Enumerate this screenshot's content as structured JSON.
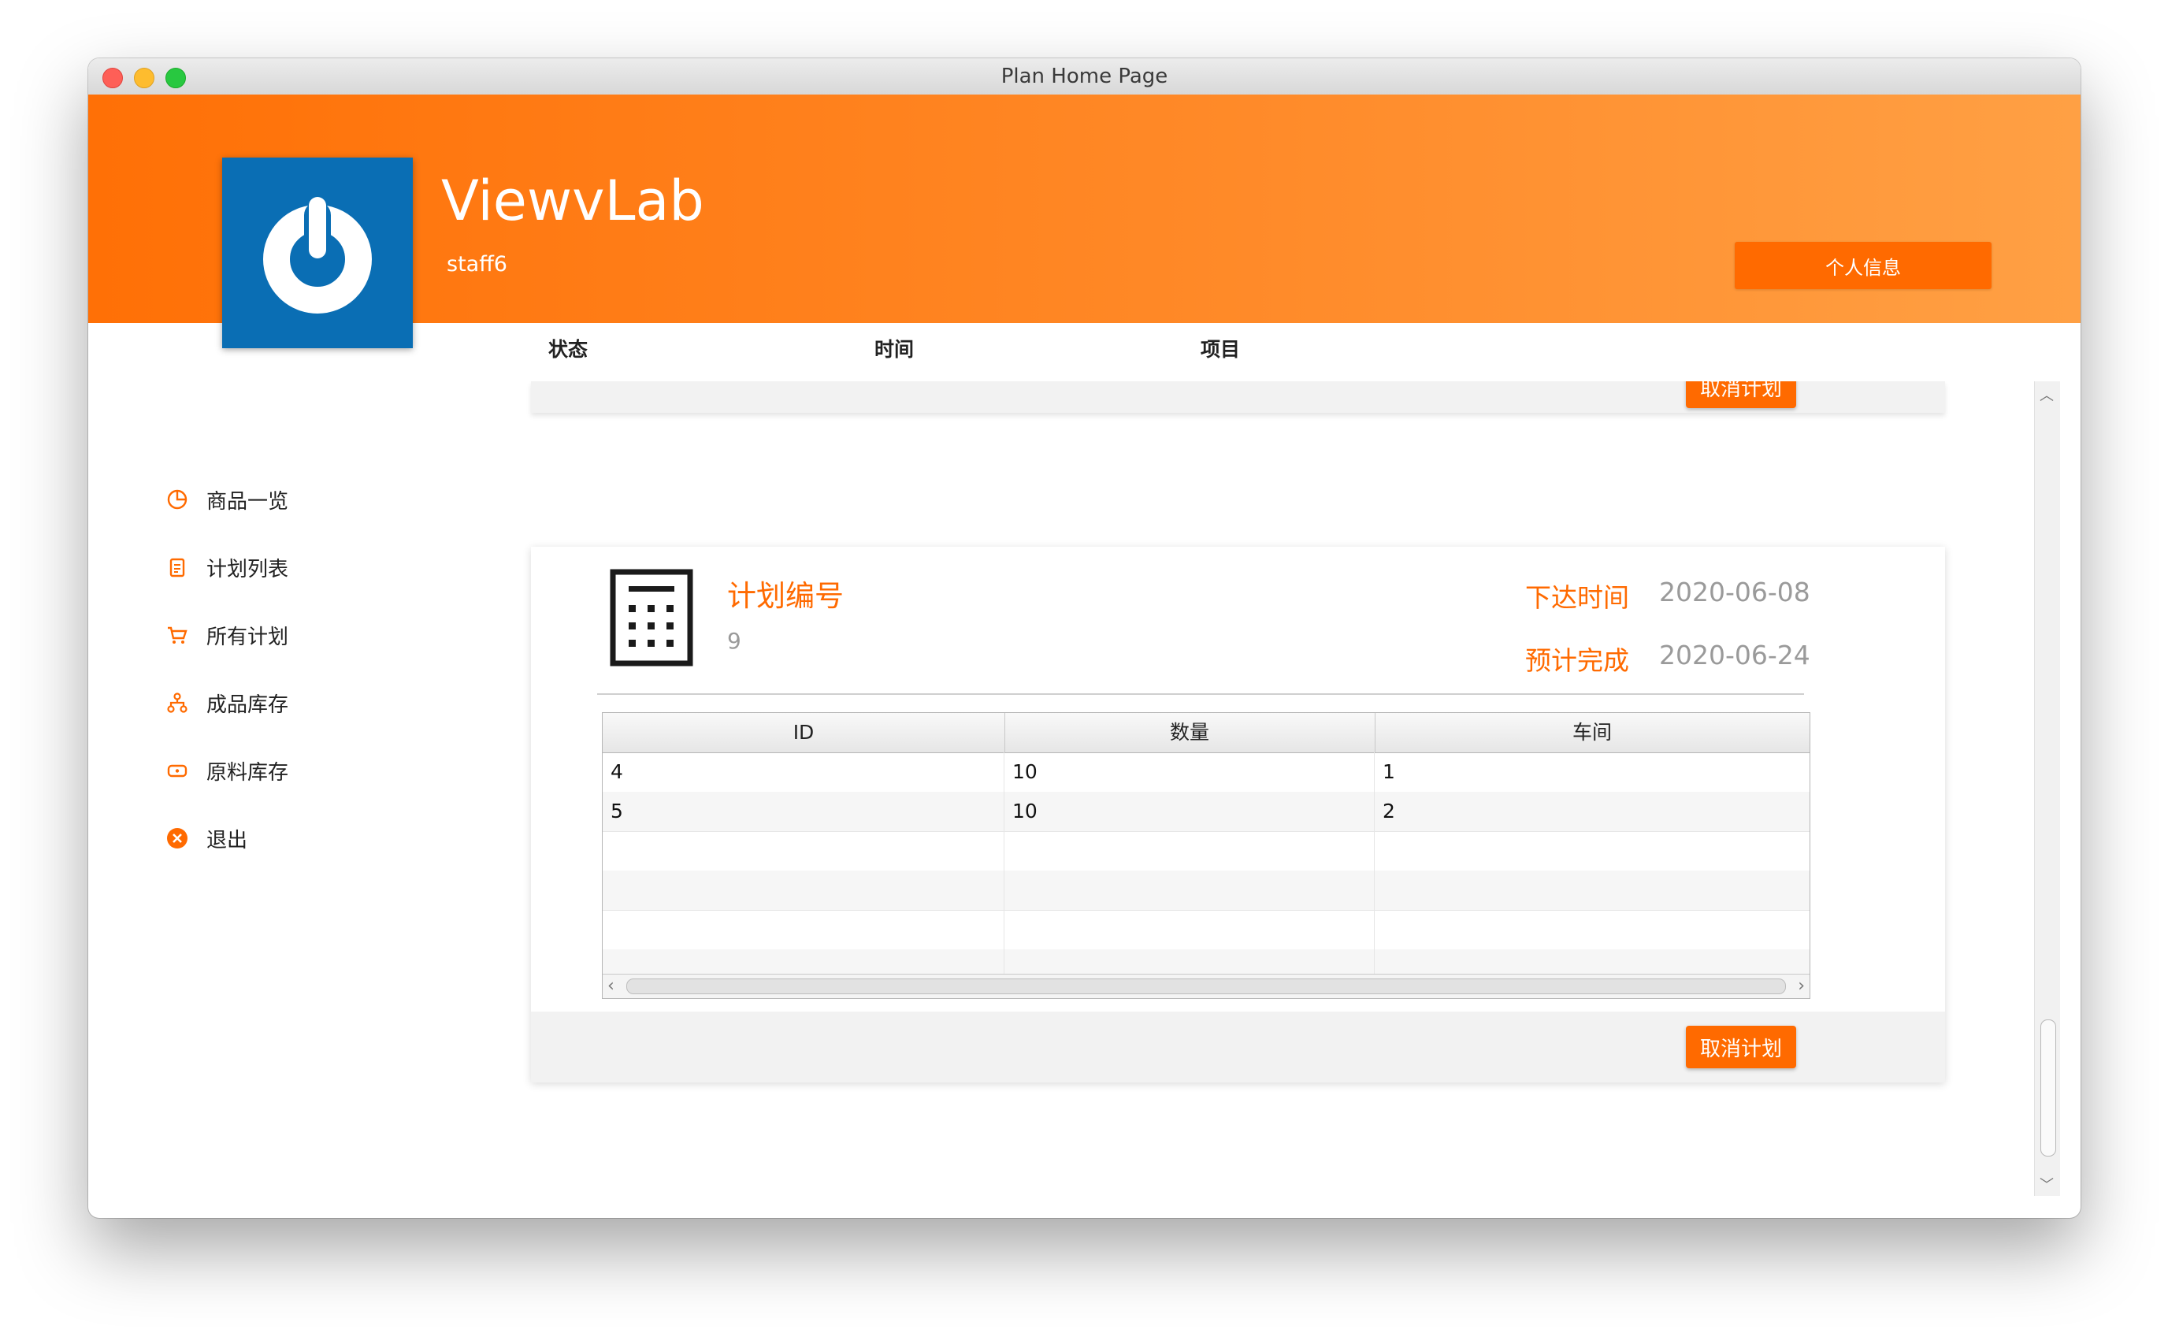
{
  "window": {
    "title": "Plan Home Page"
  },
  "header": {
    "app_name": "ViewvLab",
    "user": "staff6",
    "profile_button": "个人信息"
  },
  "columns": [
    "状态",
    "时间",
    "项目"
  ],
  "sidebar": {
    "items": [
      {
        "label": "商品一览",
        "icon": "pie-chart-icon"
      },
      {
        "label": "计划列表",
        "icon": "clipboard-icon"
      },
      {
        "label": "所有计划",
        "icon": "cart-icon"
      },
      {
        "label": "成品库存",
        "icon": "hierarchy-icon"
      },
      {
        "label": "原料库存",
        "icon": "box-icon"
      },
      {
        "label": "退出",
        "icon": "close-circle-icon"
      }
    ]
  },
  "plan": {
    "number_label": "计划编号",
    "number_value": "9",
    "issue_label": "下达时间",
    "issue_date": "2020-06-08",
    "due_label": "预计完成",
    "due_date": "2020-06-24",
    "table": {
      "headers": [
        "ID",
        "数量",
        "车间"
      ],
      "rows": [
        [
          "4",
          "10",
          "1"
        ],
        [
          "5",
          "10",
          "2"
        ]
      ]
    },
    "cancel_button": "取消计划"
  },
  "prev_card": {
    "cancel_button": "取消计划"
  },
  "colors": {
    "accent": "#ff6a00",
    "logo_bg": "#0a6eb4"
  }
}
